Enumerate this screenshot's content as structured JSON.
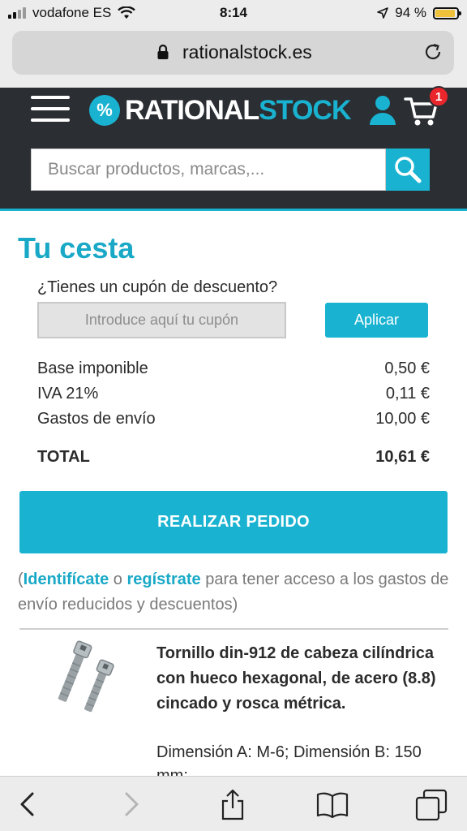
{
  "status_bar": {
    "carrier": "vodafone ES",
    "time": "8:14",
    "battery_percent": "94 %",
    "battery_level": 0.94
  },
  "browser": {
    "url": "rationalstock.es"
  },
  "header": {
    "logo_symbol": "%",
    "logo_part1": "RATIONAL",
    "logo_part2": "STOCK",
    "cart_count": "1",
    "search_placeholder": "Buscar productos, marcas,..."
  },
  "cart": {
    "title": "Tu cesta",
    "coupon_label": "¿Tienes un cupón de descuento?",
    "coupon_placeholder": "Introduce aquí tu cupón",
    "apply_label": "Aplicar",
    "summary": [
      {
        "label": "Base imponible",
        "value": "0,50 €"
      },
      {
        "label": "IVA 21%",
        "value": "0,11 €"
      },
      {
        "label": "Gastos de envío",
        "value": "10,00 €"
      }
    ],
    "total_label": "TOTAL",
    "total_value": "10,61 €",
    "order_button": "REALIZAR PEDIDO",
    "login_note": {
      "open_paren": "(",
      "login_link": "Identifícate",
      "or": " o ",
      "register_link": "regístrate",
      "rest": " para tener acceso a los gastos de envío reducidos y descuentos)"
    },
    "product": {
      "name": "Tornillo din-912 de cabeza cilíndrica con hueco hexagonal, de acero (8.8) cincado y rosca métrica.",
      "dimensions": "Dimensión A: M-6; Dimensión B: 150 mm;"
    }
  },
  "colors": {
    "accent": "#19b3d1",
    "header_bg": "#2b2e33",
    "badge": "#e8262b"
  }
}
